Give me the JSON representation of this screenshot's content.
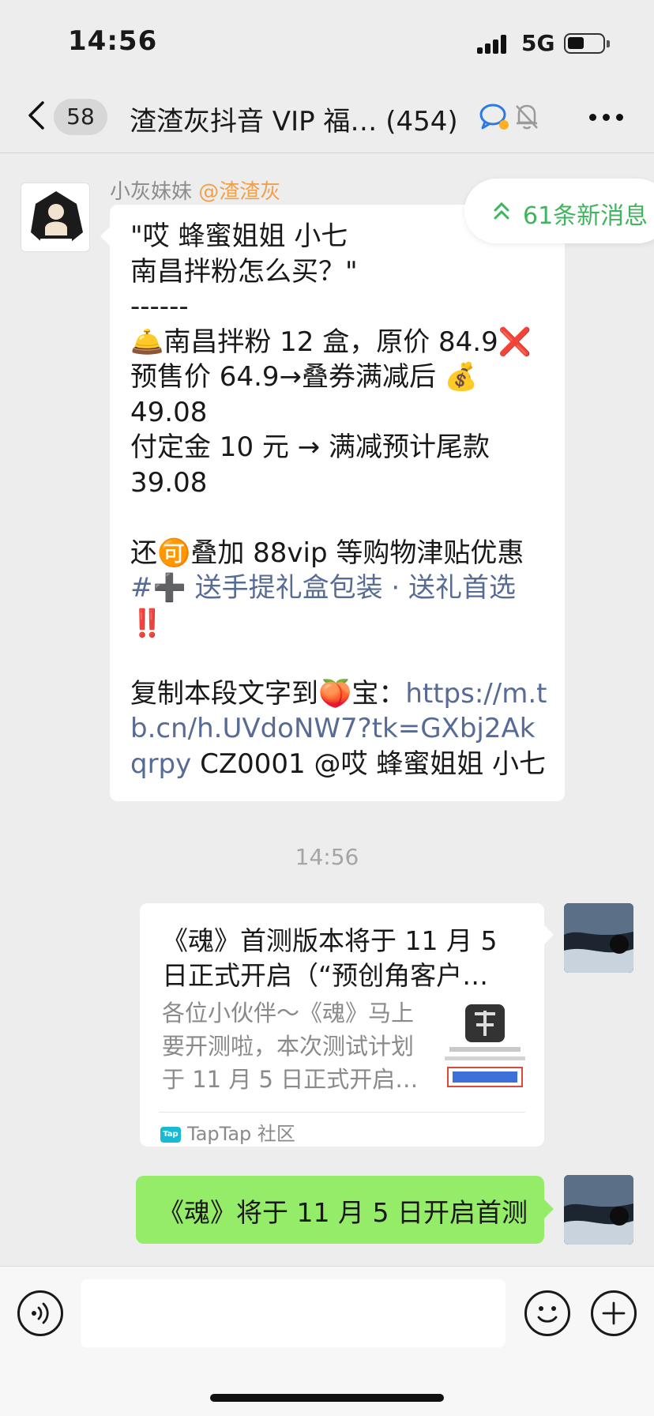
{
  "status_bar": {
    "time": "14:56",
    "network": "5G"
  },
  "header": {
    "unread_count": "58",
    "title": "渣渣灰抖音 VIP 福…  (454)"
  },
  "new_messages_pill": {
    "label": "61条新消息"
  },
  "incoming_message": {
    "sender": "小灰妹妹",
    "mention": "@渣渣灰",
    "text_before_link": "\"哎 蜂蜜姐姐 小七\n南昌拌粉怎么买？\"\n------\n🛎️南昌拌粉 12 盒，原价 84.9❌\n预售价 64.9→叠券满减后 💰\n49.08\n付定金 10 元 → 满减预计尾款\n39.08\n\n还🉑叠加 88vip 等购物津贴优惠\n",
    "hashtag": "#➕ 送手提礼盒包装 · 送礼首选",
    "text_mid": "\n‼️\n\n复制本段文字到🍑宝：",
    "url": "https://m.tb.cn/h.UVdoNW7?tk=GXbj2Akqrpy",
    "text_after_link": " CZ0001 @哎 蜂蜜姐姐 小七"
  },
  "timestamp": "14:56",
  "link_card": {
    "title": "《魂》首测版本将于 11 月 5 日正式开启（“预创角客户…",
    "description": "各位小伙伴～《魂》马上要开测啦，本次测试计划于 11 月 5 日正式开启…",
    "source": "TapTap 社区",
    "source_icon_text": "Tap"
  },
  "outgoing_message": {
    "text": "《魂》将于 11 月 5 日开启首测"
  },
  "input_bar": {
    "placeholder": ""
  }
}
